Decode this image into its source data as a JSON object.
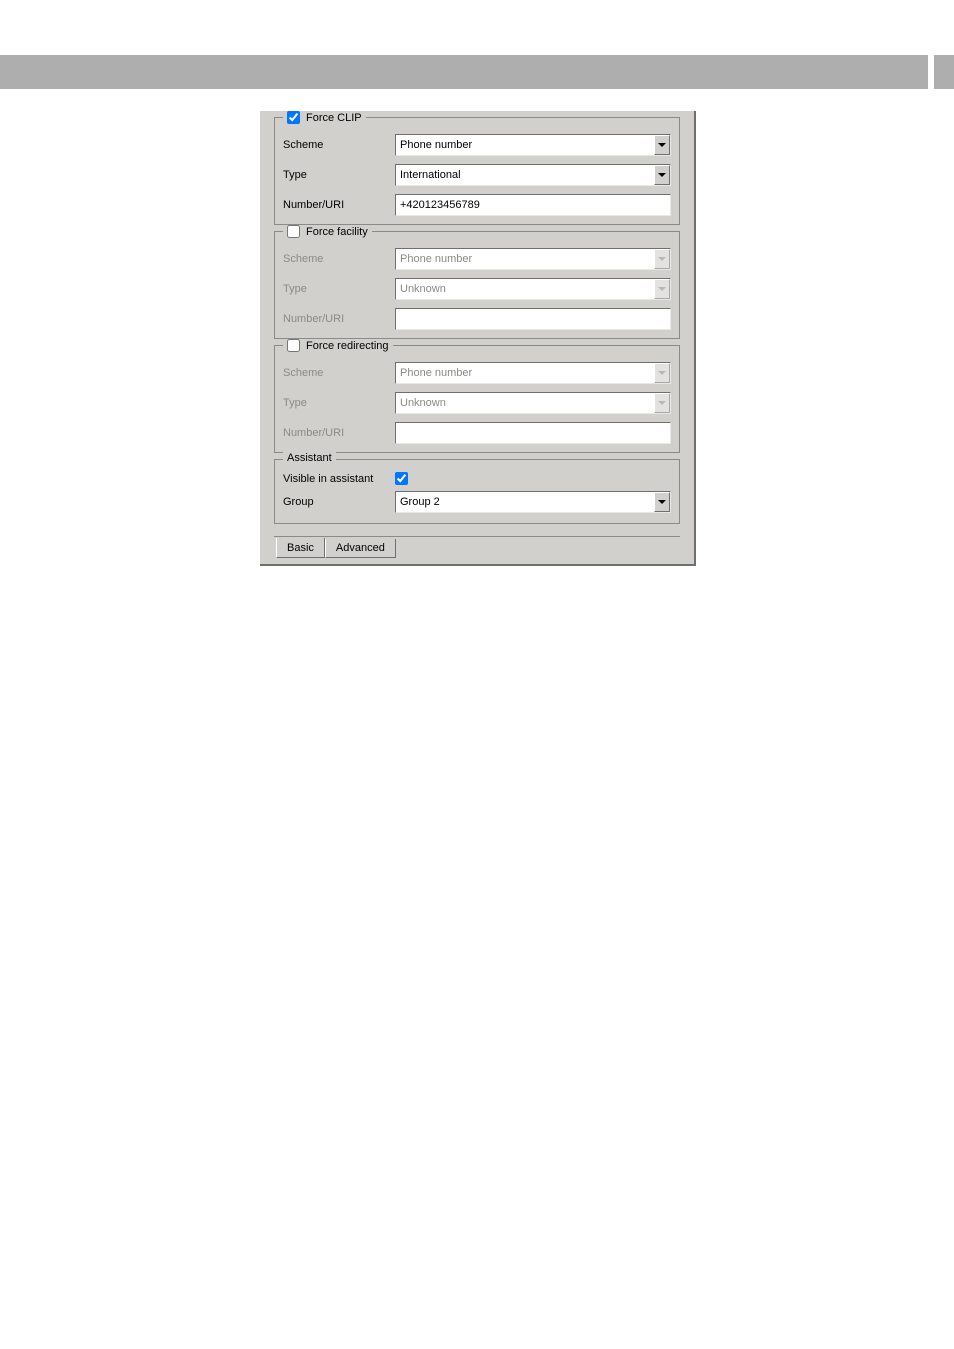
{
  "groups": {
    "force_clip": {
      "title": "Force CLIP",
      "checked": true,
      "scheme_label": "Scheme",
      "scheme_value": "Phone number",
      "type_label": "Type",
      "type_value": "International",
      "number_label": "Number/URI",
      "number_value": "+420123456789"
    },
    "force_facility": {
      "title": "Force facility",
      "checked": false,
      "scheme_label": "Scheme",
      "scheme_value": "Phone number",
      "type_label": "Type",
      "type_value": "Unknown",
      "number_label": "Number/URI",
      "number_value": ""
    },
    "force_redirecting": {
      "title": "Force redirecting",
      "checked": false,
      "scheme_label": "Scheme",
      "scheme_value": "Phone number",
      "type_label": "Type",
      "type_value": "Unknown",
      "number_label": "Number/URI",
      "number_value": ""
    }
  },
  "assistant": {
    "title": "Assistant",
    "visible_label": "Visible in assistant",
    "visible_checked": true,
    "group_label": "Group",
    "group_value": "Group 2"
  },
  "tabs": {
    "basic": "Basic",
    "advanced": "Advanced"
  }
}
